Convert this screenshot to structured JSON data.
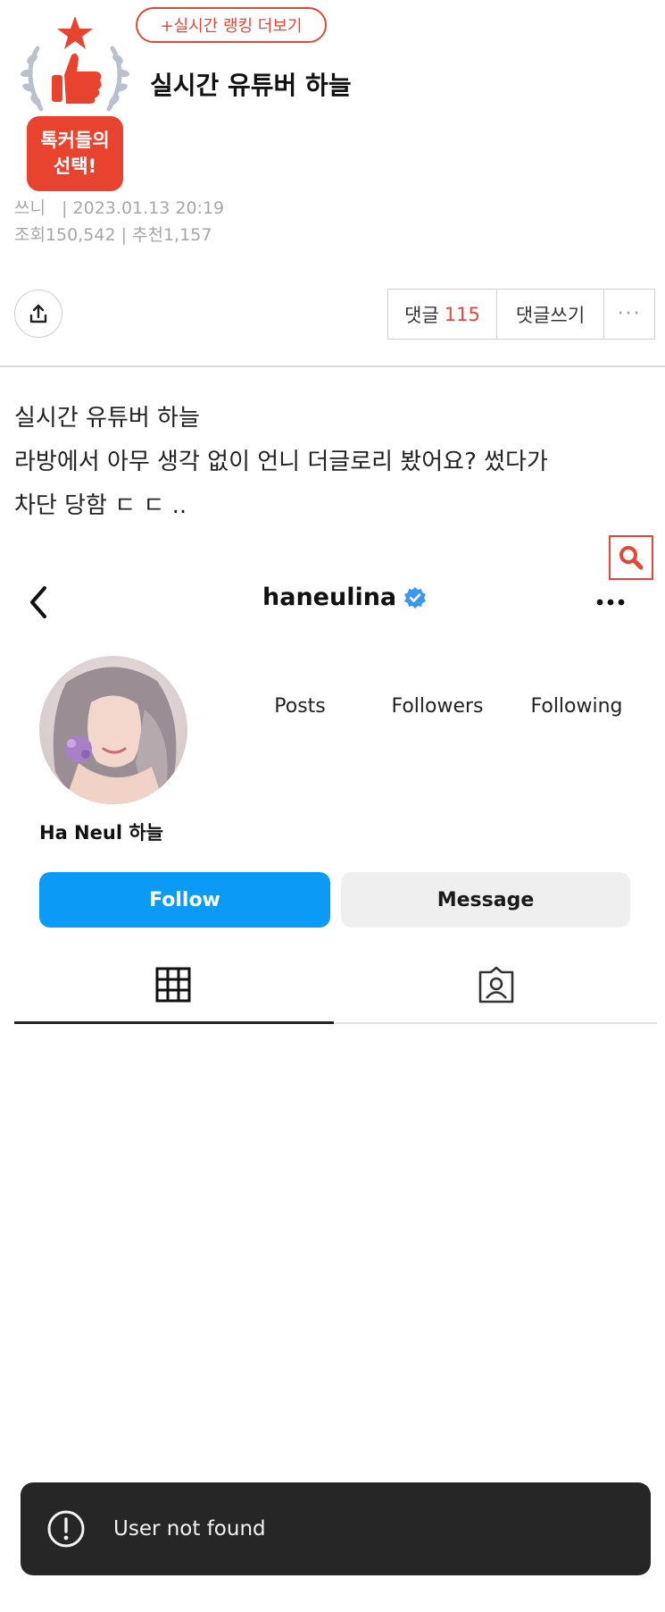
{
  "header": {
    "ranking_link": "+실시간 랭킹 더보기",
    "badge_line1": "톡커들의",
    "badge_line2": "선택!",
    "title": "실시간 유튜버 하늘",
    "author": "쓰니",
    "datetime": "2023.01.13 20:19",
    "views_label": "조회",
    "views": "150,542",
    "recommend_label": "추천",
    "recommend": "1,157"
  },
  "actions": {
    "comments_label": "댓글",
    "comments_count": "115",
    "write_comment": "댓글쓰기",
    "more": "···"
  },
  "post": {
    "lines": [
      "실시간 유튜버 하늘",
      "라방에서 아무 생각 없이 언니 더글로리 봤어요? 썼다가",
      "차단 당함 ㄷ ㄷ .."
    ]
  },
  "instagram": {
    "username": "haneulina",
    "stats": {
      "posts": "Posts",
      "followers": "Followers",
      "following": "Following"
    },
    "display_name": "Ha Neul 하늘",
    "follow_button": "Follow",
    "message_button": "Message",
    "toast": "User not found"
  },
  "colors": {
    "brand_red": "#e0493a",
    "follow_blue": "#0c9af7",
    "toast_bg": "#262626"
  }
}
